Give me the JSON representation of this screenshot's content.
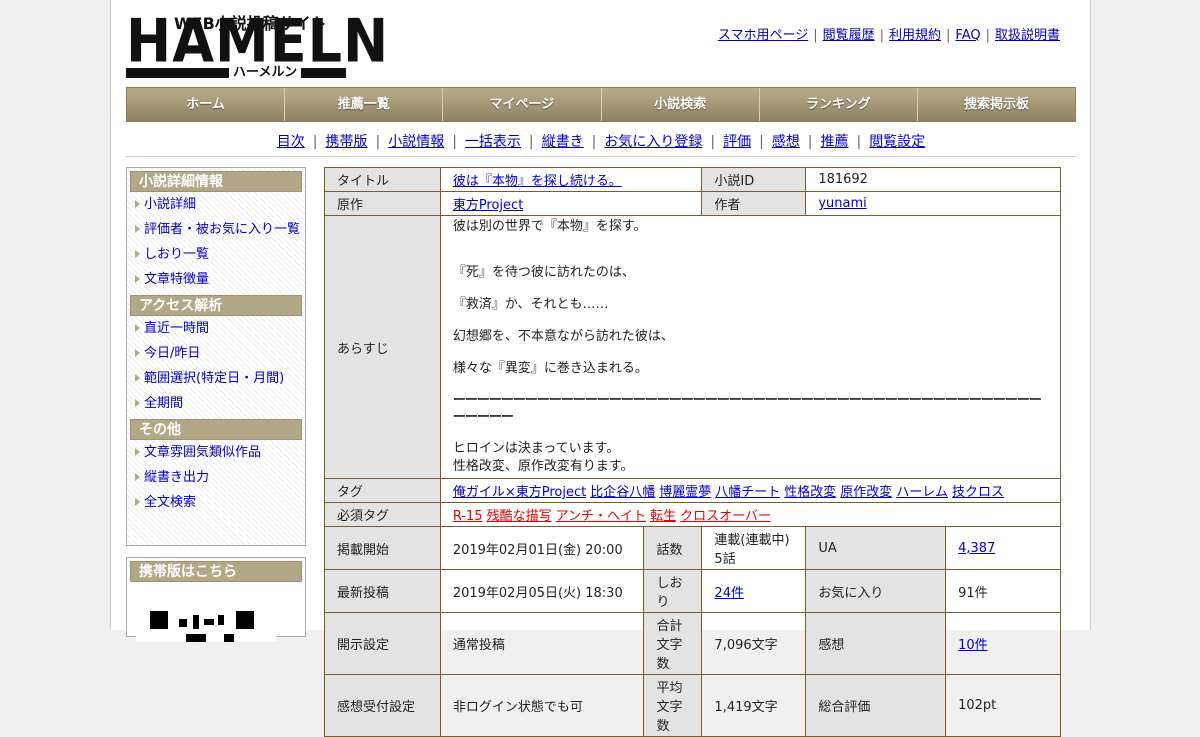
{
  "logo": {
    "big": "HAMELN",
    "tagline": "WEB小説投稿サイト",
    "kana": "ハーメルン"
  },
  "top_links": [
    "スマホ用ページ",
    "閲覧履歴",
    "利用規約",
    "FAQ",
    "取扱説明書"
  ],
  "main_nav": [
    "ホーム",
    "推薦一覧",
    "マイページ",
    "小説検索",
    "ランキング",
    "捜索掲示板"
  ],
  "sub_nav": [
    "目次",
    "携帯版",
    "小説情報",
    "一括表示",
    "縦書き",
    "お気に入り登録",
    "評価",
    "感想",
    "推薦",
    "閲覧設定"
  ],
  "sidebar": {
    "sections": [
      {
        "title": "小説詳細情報",
        "items": [
          "小説詳細",
          "評価者・被お気に入り一覧",
          "しおり一覧",
          "文章特徴量"
        ]
      },
      {
        "title": "アクセス解析",
        "items": [
          "直近一時間",
          "今日/昨日",
          "範囲選択(特定日・月間)",
          "全期間"
        ]
      },
      {
        "title": "その他",
        "items": [
          "文章雰囲気類似作品",
          "縦書き出力",
          "全文検索"
        ]
      }
    ],
    "mobile_title": "携帯版はこちら"
  },
  "info": {
    "title_label": "タイトル",
    "title": "彼は『本物』を探し続ける。",
    "novel_id_label": "小説ID",
    "novel_id": "181692",
    "original_label": "原作",
    "original": "東方Project",
    "author_label": "作者",
    "author": "yunami",
    "synopsis_label": "あらすじ",
    "synopsis_lines": [
      "彼は別の世界で『本物』を探す。",
      "『死』を待つ彼に訪れたのは、",
      "『救済』か、それとも……",
      "幻想郷を、不本意ながら訪れた彼は、",
      "様々な『異変』に巻き込まれる。",
      "ーーーーーーーーーーーーーーーーーーーーーーーーーーーーーーーーーーーーーーーーーーーーーーーーーーーーーー",
      "ヒロインは決まっています。",
      "性格改変、原作改変有ります。"
    ],
    "tags_label": "タグ",
    "tags": [
      "俺ガイル×東方Project",
      "比企谷八幡",
      "博麗霊夢",
      "八幡チート",
      "性格改変",
      "原作改変",
      "ハーレム",
      "技クロス"
    ],
    "required_tags_label": "必須タグ",
    "required_tags": [
      "R-15",
      "残酷な描写",
      "アンチ・ヘイト",
      "転生",
      "クロスオーバー"
    ],
    "stats": [
      [
        "掲載開始",
        "2019年02月01日(金) 20:00",
        "話数",
        "連載(連載中) 5話",
        "UA",
        "4,387"
      ],
      [
        "最新投稿",
        "2019年02月05日(火) 18:30",
        "しおり",
        "24件",
        "お気に入り",
        "91件"
      ],
      [
        "開示設定",
        "通常投稿",
        "合計文字数",
        "7,096文字",
        "感想",
        "10件"
      ],
      [
        "感想受付設定",
        "非ログイン状態でも可",
        "平均文字数",
        "1,419文字",
        "総合評価",
        "102pt"
      ]
    ]
  },
  "colors": {
    "link": "#0000cc",
    "red_tag": "#ee0000",
    "nav_gold": "#a89c7a",
    "table_border": "#7a5a2e"
  }
}
